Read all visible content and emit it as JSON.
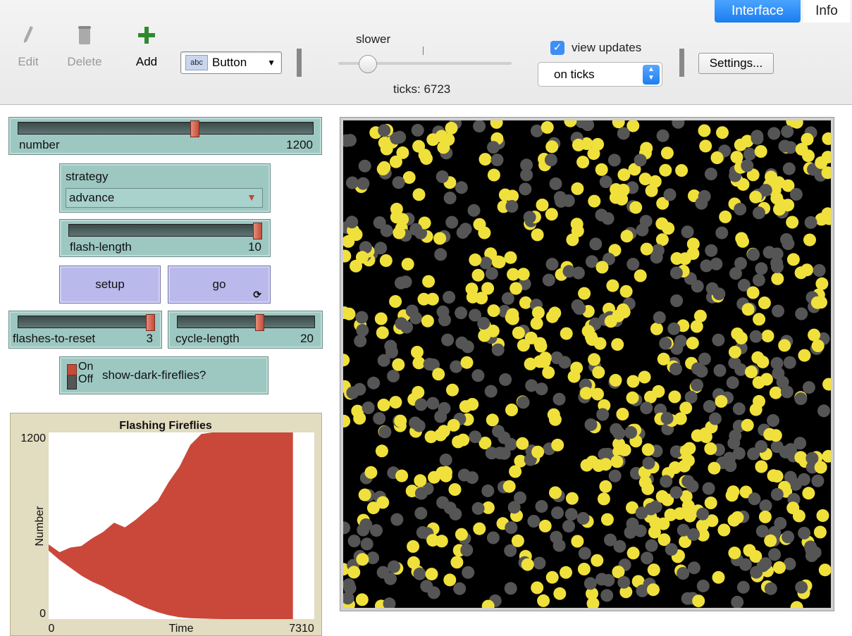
{
  "tabs": {
    "interface": "Interface",
    "info": "Info"
  },
  "toolbar": {
    "edit_label": "Edit",
    "delete_label": "Delete",
    "add_label": "Add",
    "widget_type": "Button",
    "speed_label": "slower",
    "ticks_text": "ticks: 6723",
    "view_updates_label": "view updates",
    "view_updates_checked": true,
    "update_mode": "on ticks",
    "settings_label": "Settings..."
  },
  "widgets": {
    "number": {
      "label": "number",
      "value": "1200",
      "fraction": 0.6
    },
    "strategy": {
      "label": "strategy",
      "value": "advance"
    },
    "flash_length": {
      "label": "flash-length",
      "value": "10",
      "fraction": 1.0
    },
    "setup_label": "setup",
    "go_label": "go",
    "flashes_to_reset": {
      "label": "flashes-to-reset",
      "value": "3",
      "fraction": 1.0
    },
    "cycle_length": {
      "label": "cycle-length",
      "value": "20",
      "fraction": 0.6
    },
    "switch": {
      "on": "On",
      "off": "Off",
      "label": "show-dark-fireflies?"
    }
  },
  "chart_data": {
    "type": "area",
    "title": "Flashing Fireflies",
    "xlabel": "Time",
    "ylabel": "Number",
    "xlim": [
      0,
      7310
    ],
    "ylim": [
      0,
      1200
    ],
    "x_tick_labels": [
      "0",
      "7310"
    ],
    "y_tick_labels": [
      "0",
      "1200"
    ],
    "series": [
      {
        "color": "#c9483a",
        "x": [
          0,
          300,
          600,
          900,
          1200,
          1500,
          1800,
          2100,
          2400,
          2700,
          3000,
          3300,
          3600,
          3900,
          4200,
          4500,
          4800,
          5100,
          5400,
          5700,
          6000,
          6300,
          6600,
          6723
        ],
        "high": [
          480,
          430,
          460,
          470,
          520,
          560,
          620,
          590,
          640,
          700,
          760,
          880,
          980,
          1120,
          1190,
          1200,
          1200,
          1200,
          1200,
          1200,
          1200,
          1200,
          1200,
          1200
        ],
        "low": [
          440,
          380,
          330,
          280,
          240,
          210,
          170,
          140,
          100,
          70,
          45,
          25,
          12,
          6,
          3,
          1,
          0,
          0,
          0,
          0,
          0,
          0,
          0,
          0
        ]
      }
    ]
  },
  "colors": {
    "widget_teal": "#9dc8c2",
    "button_lavender": "#b9b9ec",
    "plot_bg": "#e2dcc0",
    "firefly_on": "#f0e03c",
    "firefly_off": "#555555",
    "accent_blue": "#1a7df0"
  }
}
